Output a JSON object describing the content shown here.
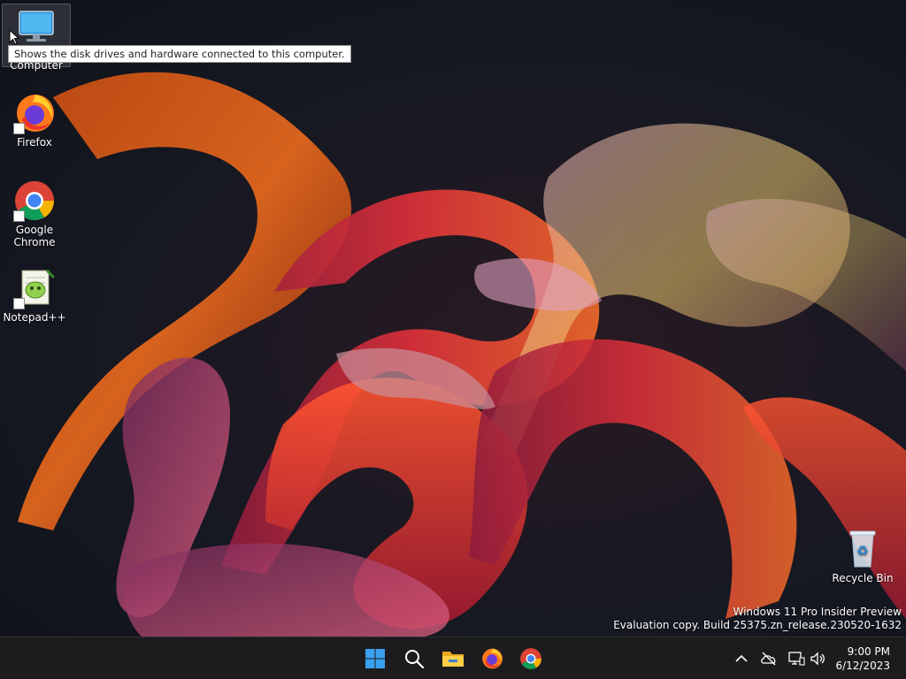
{
  "desktop": {
    "icons": [
      {
        "label": "My Computer",
        "icon": "monitor-icon"
      },
      {
        "label": "Firefox",
        "icon": "firefox-icon"
      },
      {
        "label": "Google Chrome",
        "icon": "chrome-icon"
      },
      {
        "label": "Notepad++",
        "icon": "notepad-plus-plus-icon"
      },
      {
        "label": "Recycle Bin",
        "icon": "recycle-bin-icon"
      }
    ],
    "tooltip": "Shows the disk drives and hardware connected to this computer.",
    "watermark": {
      "line1": "Windows 11 Pro Insider Preview",
      "line2": "Evaluation copy. Build 25375.zn_release.230520-1632"
    }
  },
  "taskbar": {
    "apps": [
      "start-icon",
      "search-icon",
      "file-explorer-icon",
      "firefox-icon",
      "chrome-icon"
    ],
    "tray": [
      "chevron-up-icon",
      "network-off-icon",
      "display-network-icon",
      "volume-icon"
    ],
    "time": "9:00 PM",
    "date": "6/12/2023"
  },
  "colors": {
    "taskbar_bg": "#1c1c1f",
    "accent_blue": "#3aa0f0"
  }
}
